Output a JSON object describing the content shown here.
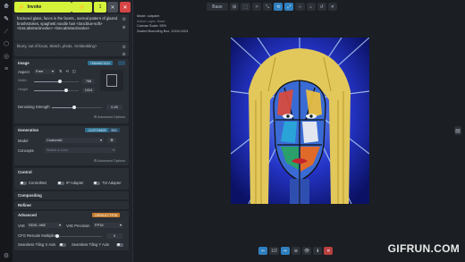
{
  "left_nav": {
    "items": [
      {
        "icon": "invoke-logo-icon",
        "glyph": "⟰"
      },
      {
        "icon": "text-to-image-icon",
        "glyph": "✎"
      },
      {
        "icon": "brush-icon",
        "glyph": "⟋"
      },
      {
        "icon": "nodes-icon",
        "glyph": "⬡"
      },
      {
        "icon": "models-icon",
        "glyph": "◎"
      },
      {
        "icon": "queue-icon",
        "glyph": "≡"
      }
    ],
    "settings_glyph": "⚙"
  },
  "top_actions": {
    "invoke_label": "Invoke",
    "invoke_glyph": "⚡",
    "iterations_glyph": "⚡",
    "iterations_value": "1",
    "cancel_glyph": "✕",
    "clear_glyph": "✕"
  },
  "prompt": {
    "positive": "fractured glass, faces in the facets., surreal pattern of glazed brushstrokes, spaghetti noodle hair <lora:blue-soft> <lora:abstractinvoke> <lora:abstractinvoke>",
    "negative": "blurry, out of focus, sketch, photo, <embedding>",
    "side_glyphs": [
      "⚙",
      "⊕"
    ]
  },
  "image_section": {
    "title": "Image",
    "badge": "768x960/1024",
    "aspect_label": "Aspect",
    "aspect_value": "Free",
    "aspect_icons": [
      "⇅",
      "⟲",
      "◫"
    ],
    "width_label": "Width",
    "width_value": "768",
    "height_label": "Height",
    "height_value": "1024",
    "width_fraction": 0.58,
    "height_fraction": 0.72,
    "denoise_label": "Denoising Strength",
    "denoise_value": "0.45",
    "denoise_fraction": 0.45,
    "advanced_label": "Advanced Options"
  },
  "generation_section": {
    "title": "Generation",
    "badge1": "CUSTOMIZE",
    "badge2": "SD1",
    "model_label": "Model",
    "model_value": "CustomAI",
    "concepts_label": "Concepts",
    "concepts_placeholder": "Select a Lora",
    "advanced_label": "Advanced Options"
  },
  "control_section": {
    "title": "Control",
    "items": [
      {
        "label": "ControlNet"
      },
      {
        "label": "IP Adapter"
      },
      {
        "label": "T2I Adapter"
      }
    ]
  },
  "other_sections": [
    {
      "title": "Compositing"
    },
    {
      "title": "Refiner"
    }
  ],
  "advanced_section": {
    "title": "Advanced",
    "badge": "DEFAULT FP16",
    "vae_label": "VAE",
    "vae_value": "SDXL VAE",
    "vae_precision_label": "VAE Precision",
    "vae_precision_value": "FP16",
    "cfg_label": "CFG Rescale Multiplier",
    "cfg_value": "0",
    "cfg_fraction": 0.0,
    "seamless_x_label": "Seamless Tiling X Axis",
    "seamless_y_label": "Seamless Tiling Y Axis"
  },
  "canvas_controls": {
    "mode_label": "Base",
    "icons": [
      "⊞",
      "⬚",
      "✧",
      "⤡",
      "⟲",
      "⤢",
      "⊹",
      "⌂",
      "↺",
      "✕"
    ]
  },
  "canvas_info": {
    "lines": [
      "Mode: outpaint",
      "Active Layer: Base",
      "Canvas Scale: 55%",
      "Scaled Bounding Box: 1024×1024"
    ]
  },
  "bottom_controls": {
    "icons": [
      "⇦",
      "1/2",
      "⇨",
      "⊕",
      "👁",
      "⬇",
      "✕"
    ]
  },
  "watermark": "GIFRUN.COM",
  "right_collapse_glyph": "▤"
}
